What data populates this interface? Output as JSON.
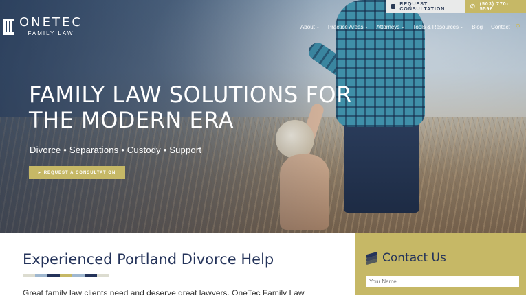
{
  "header": {
    "logo_name": "ONETEC",
    "logo_sub": "FAMILY LAW",
    "consult_label": "REQUEST CONSULTATION",
    "phone_label": "(503) 770-5596",
    "nav": [
      {
        "label": "About",
        "has_dropdown": true
      },
      {
        "label": "Practice Areas",
        "has_dropdown": true
      },
      {
        "label": "Attorneys",
        "has_dropdown": true
      },
      {
        "label": "Tools & Resources",
        "has_dropdown": true
      },
      {
        "label": "Blog",
        "has_dropdown": false
      },
      {
        "label": "Contact",
        "has_dropdown": false
      }
    ],
    "icons": {
      "search": "search-icon",
      "phone": "phone-icon",
      "consult": "chat-icon"
    }
  },
  "hero": {
    "title": "FAMILY LAW SOLUTIONS FOR THE MODERN ERA",
    "tagline": "Divorce • Separations • Custody • Support",
    "cta_label": "REQUEST A CONSULTATION"
  },
  "main": {
    "heading": "Experienced Portland Divorce Help",
    "intro": "Great family law clients need and deserve great lawyers. OneTec Family Law",
    "rule_colors": [
      "#dcdcd0",
      "#9fb7cf",
      "#24335a",
      "#c6b866",
      "#9fb7cf",
      "#24335a",
      "#dcdcd0"
    ]
  },
  "contact": {
    "title": "Contact Us",
    "name_placeholder": "Your Name"
  },
  "colors": {
    "accent": "#c6b866",
    "navy": "#24335a"
  }
}
